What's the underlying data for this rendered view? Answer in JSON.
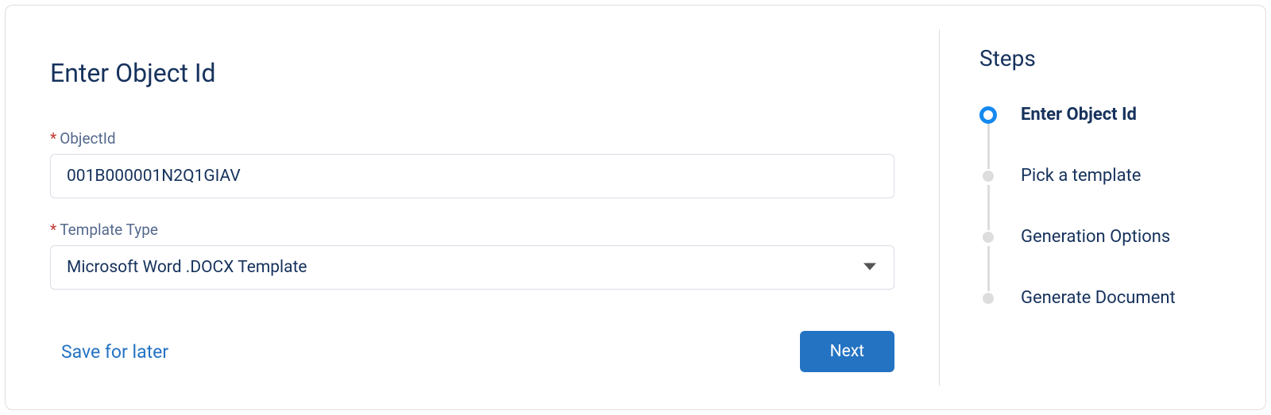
{
  "page": {
    "title": "Enter Object Id"
  },
  "form": {
    "objectId": {
      "label": "ObjectId",
      "value": "001B000001N2Q1GIAV",
      "required": true
    },
    "templateType": {
      "label": "Template Type",
      "value": "Microsoft Word .DOCX Template",
      "required": true
    }
  },
  "actions": {
    "saveForLater": "Save for later",
    "next": "Next"
  },
  "steps": {
    "title": "Steps",
    "items": [
      {
        "label": "Enter Object Id",
        "active": true
      },
      {
        "label": "Pick a template",
        "active": false
      },
      {
        "label": "Generation Options",
        "active": false
      },
      {
        "label": "Generate Document",
        "active": false
      }
    ]
  }
}
